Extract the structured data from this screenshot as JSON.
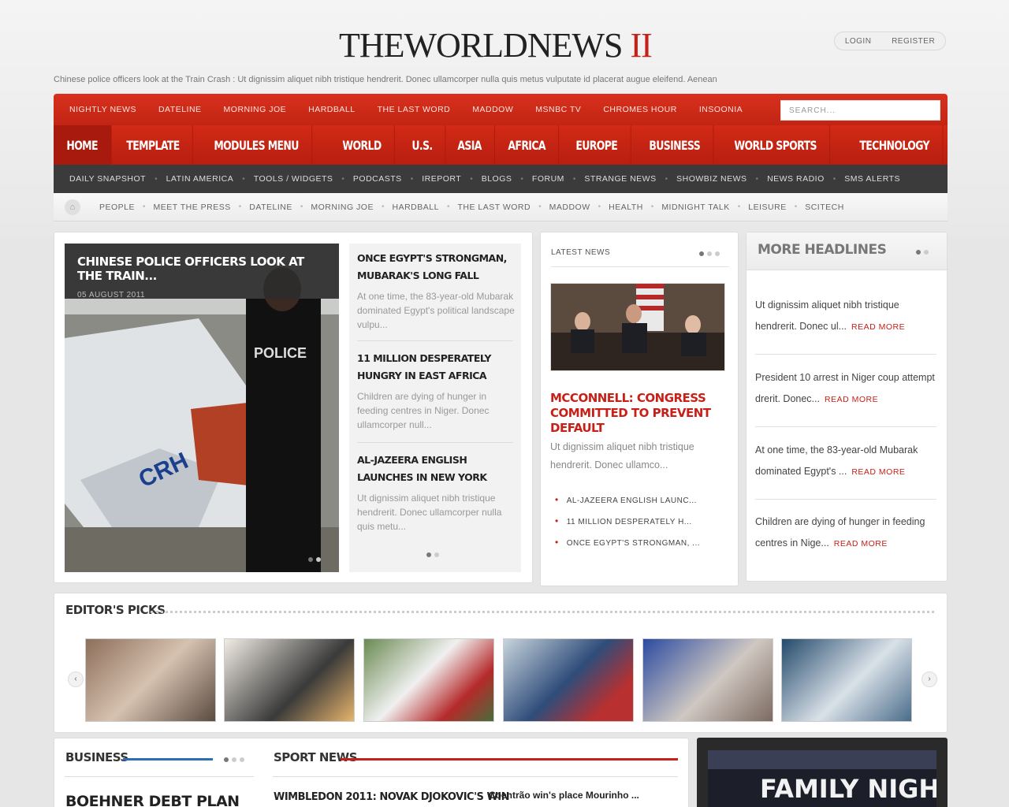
{
  "header": {
    "logo_main": "THEWORLDNEWS",
    "logo_suffix": "II",
    "login": "LOGIN",
    "register": "REGISTER",
    "ticker": "Chinese police officers look at the Train Crash : Ut dignissim aliquet nibh tristique hendrerit. Donec ullamcorper nulla quis metus vulputate id placerat augue eleifend. Aenean"
  },
  "nav_top": [
    "NIGHTLY NEWS",
    "DATELINE",
    "MORNING JOE",
    "HARDBALL",
    "THE LAST WORD",
    "MADDOW",
    "MSNBC TV",
    "CHROMES HOUR",
    "INSOONIA"
  ],
  "search": {
    "placeholder": "SEARCH..."
  },
  "nav_main": [
    "HOME",
    "TEMPLATE",
    "MODULES MENU",
    "WORLD",
    "U.S.",
    "ASIA",
    "AFRICA",
    "EUROPE",
    "BUSINESS",
    "WORLD SPORTS",
    "TECHNOLOGY"
  ],
  "nav_dark": [
    "DAILY SNAPSHOT",
    "LATIN AMERICA",
    "TOOLS / WIDGETS",
    "PODCASTS",
    "IREPORT",
    "BLOGS",
    "FORUM",
    "STRANGE NEWS",
    "SHOWBIZ NEWS",
    "NEWS RADIO",
    "SMS ALERTS"
  ],
  "nav_light": [
    "PEOPLE",
    "MEET THE PRESS",
    "DATELINE",
    "MORNING JOE",
    "HARDBALL",
    "THE LAST WORD",
    "MADDOW",
    "HEALTH",
    "MIDNIGHT TALK",
    "LEISURE",
    "SCITECH"
  ],
  "feature": {
    "title": "CHINESE POLICE OFFICERS LOOK AT THE TRAIN...",
    "date": "05 AUGUST 2011",
    "side": [
      {
        "title": "ONCE EGYPT'S STRONGMAN, MUBARAK'S LONG FALL",
        "summary": "At one time, the 83-year-old Mubarak dominated Egypt's political landscape vulpu..."
      },
      {
        "title": "11 MILLION DESPERATELY HUNGRY IN EAST AFRICA",
        "summary": "Children are dying of hunger in feeding centres in Niger. Donec ullamcorper null..."
      },
      {
        "title": "AL-JAZEERA ENGLISH LAUNCHES IN NEW YORK",
        "summary": "Ut dignissim aliquet nibh tristique hendrerit. Donec ullamcorper nulla quis metu..."
      }
    ]
  },
  "latest": {
    "heading": "LATEST NEWS",
    "title": "MCCONNELL: CONGRESS COMMITTED TO PREVENT DEFAULT",
    "text": "Ut dignissim aliquet nibh tristique hendrerit. Donec ullamco...",
    "links": [
      "AL-JAZEERA ENGLISH LAUNC...",
      "11 MILLION DESPERATELY H...",
      "ONCE EGYPT'S STRONGMAN, ..."
    ]
  },
  "more": {
    "heading": "MORE HEADLINES",
    "read_more": "READ MORE",
    "items": [
      "Ut dignissim aliquet nibh tristique hendrerit. Donec ul...",
      "President 10 arrest in Niger coup attempt drerit. Donec...",
      "At one time, the 83-year-old Mubarak dominated Egypt's ...",
      "Children are dying of hunger in feeding centres in Nige..."
    ]
  },
  "picks": {
    "heading": "EDITOR'S PICKS"
  },
  "bottom": {
    "business": "BUSINESS",
    "sport": "SPORT NEWS",
    "boehner": "BOEHNER DEBT PLAN",
    "wimbledon": "WIMBLEDON 2011: NOVAK DJOKOVIC'S WIN",
    "coentrao": "Coentrão win's place Mourinho ...",
    "promo": "FAMILY NIGHT"
  },
  "colors": {
    "accent": "#c62018",
    "nav_dark": "#3b3b3b",
    "business_line": "#2b6eb8"
  }
}
